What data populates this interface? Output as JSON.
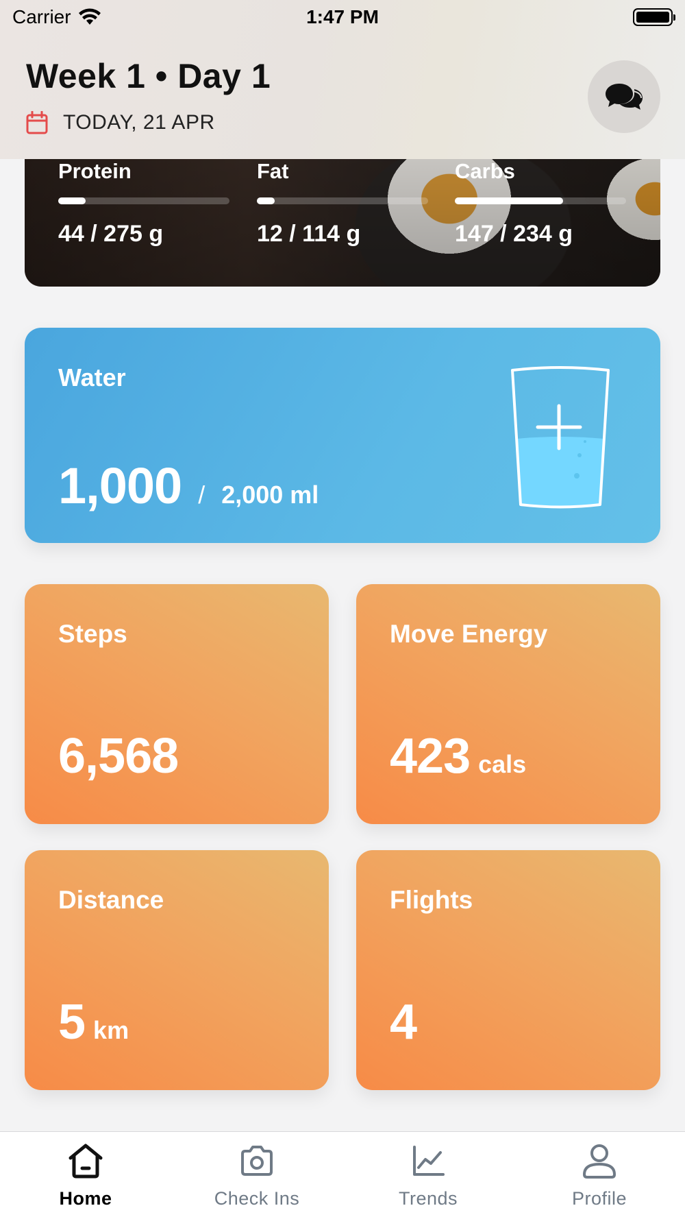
{
  "status_bar": {
    "carrier": "Carrier",
    "time": "1:47 PM"
  },
  "header": {
    "title": "Week 1 • Day 1",
    "date": "TODAY, 21 APR"
  },
  "macros": [
    {
      "label": "Protein",
      "current": 44,
      "goal": 275,
      "value_text": "44 / 275 g",
      "progress": 0.16
    },
    {
      "label": "Fat",
      "current": 12,
      "goal": 114,
      "value_text": "12 / 114 g",
      "progress": 0.105
    },
    {
      "label": "Carbs",
      "current": 147,
      "goal": 234,
      "value_text": "147 / 234 g",
      "progress": 0.63
    }
  ],
  "water": {
    "label": "Water",
    "current": "1,000",
    "separator": "/",
    "goal": "2,000 ml"
  },
  "stats": [
    {
      "label": "Steps",
      "value": "6,568",
      "unit": ""
    },
    {
      "label": "Move Energy",
      "value": "423",
      "unit": "cals"
    },
    {
      "label": "Distance",
      "value": "5",
      "unit": "km"
    },
    {
      "label": "Flights",
      "value": "4",
      "unit": ""
    }
  ],
  "tabs": [
    {
      "label": "Home",
      "icon": "home-icon",
      "active": true
    },
    {
      "label": "Check Ins",
      "icon": "camera-icon",
      "active": false
    },
    {
      "label": "Trends",
      "icon": "chart-icon",
      "active": false
    },
    {
      "label": "Profile",
      "icon": "person-icon",
      "active": false
    }
  ],
  "colors": {
    "accent_red": "#e44b4b",
    "water_blue": "#4aa6de",
    "stat_orange": "#f39a55"
  }
}
